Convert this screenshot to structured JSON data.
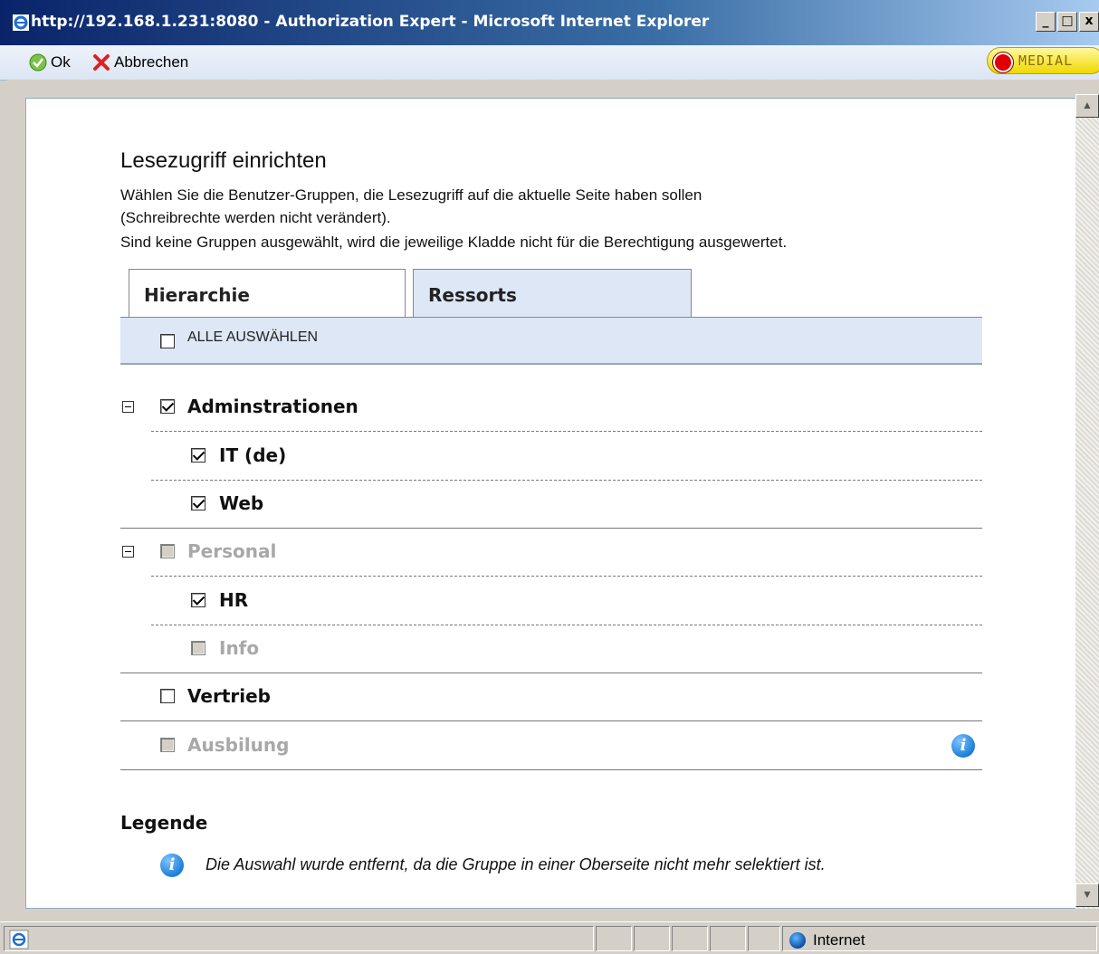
{
  "window": {
    "title": "http://192.168.1.231:8080 - Authorization Expert - Microsoft Internet Explorer",
    "buttons": {
      "minimize": "_",
      "maximize": "□",
      "close": "x"
    }
  },
  "toolbar": {
    "ok_label": "Ok",
    "cancel_label": "Abbrechen",
    "logo_text": "MEDIAL"
  },
  "page": {
    "heading": "Lesezugriff einrichten",
    "description_lines": [
      "Wählen Sie die Benutzer-Gruppen, die Lesezugriff auf die aktuelle Seite haben sollen",
      "(Schreibrechte werden nicht verändert).",
      "Sind keine Gruppen ausgewählt, wird die jeweilige Kladde nicht für die Berechtigung ausgewertet."
    ],
    "tabs": [
      {
        "label": "Hierarchie",
        "active": false
      },
      {
        "label": "Ressorts",
        "active": true
      }
    ],
    "select_all_label": "ALLE AUSWÄHLEN",
    "groups": [
      {
        "label": "Adminstrationen",
        "checked": true,
        "disabled": false,
        "expanded": true,
        "children": [
          {
            "label": "IT (de)",
            "checked": true,
            "disabled": false
          },
          {
            "label": "Web",
            "checked": true,
            "disabled": false
          }
        ]
      },
      {
        "label": "Personal",
        "checked": false,
        "disabled": true,
        "expanded": true,
        "children": [
          {
            "label": "HR",
            "checked": true,
            "disabled": false
          },
          {
            "label": "Info",
            "checked": false,
            "disabled": true
          }
        ]
      },
      {
        "label": "Vertrieb",
        "checked": false,
        "disabled": false
      },
      {
        "label": "Ausbilung",
        "checked": false,
        "disabled": true,
        "info": true
      }
    ],
    "legend": {
      "title": "Legende",
      "icon": "info-icon",
      "text": "Die Auswahl wurde entfernt, da die Gruppe in einer Oberseite nicht mehr selektiert ist."
    }
  },
  "statusbar": {
    "zone": "Internet"
  },
  "colors": {
    "accent": "#0a246a",
    "tab_active_bg": "#dde7f5",
    "disabled_text": "#a8a8a8",
    "info_blue": "#1c7fd8"
  }
}
